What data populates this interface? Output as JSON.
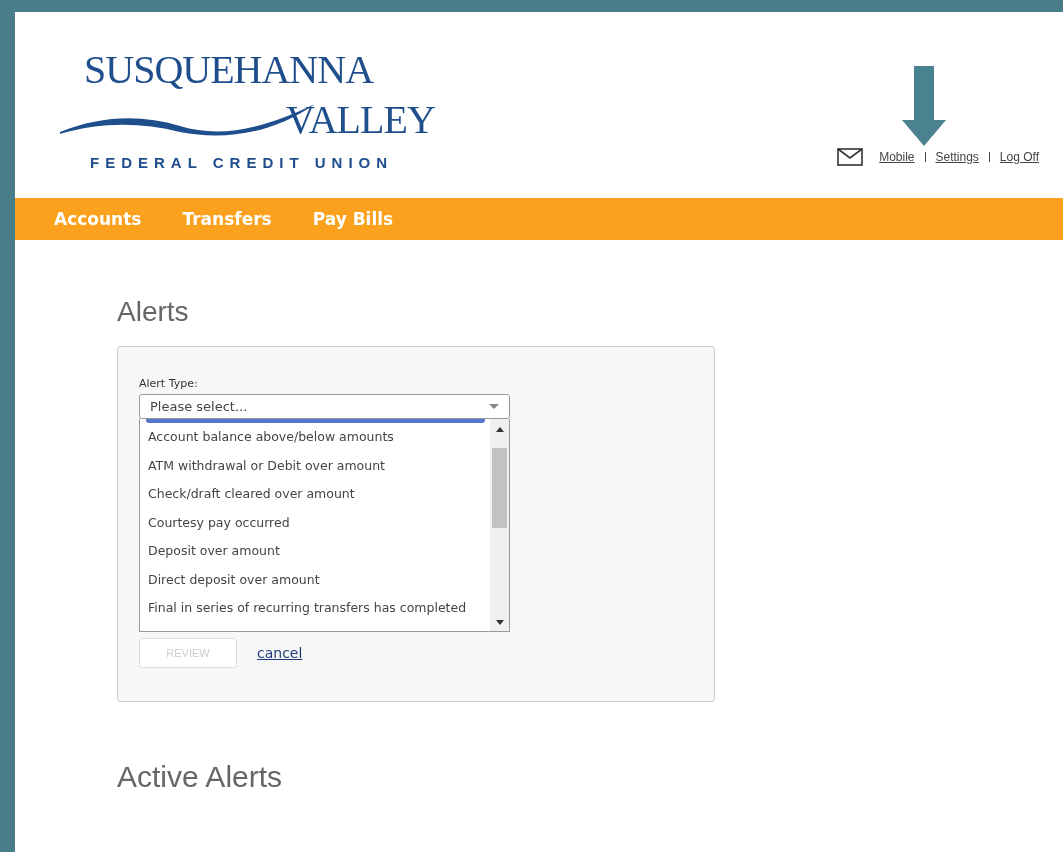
{
  "logo": {
    "line_1": "SUSQUEHANNA",
    "line_2": "VALLEY",
    "line_3": "FEDERAL CREDIT UNION"
  },
  "header_links": [
    {
      "label": "Mobile"
    },
    {
      "label": "Settings"
    },
    {
      "label": "Log Off"
    }
  ],
  "nav": [
    {
      "label": "Accounts"
    },
    {
      "label": "Transfers"
    },
    {
      "label": "Pay Bills"
    }
  ],
  "page_title": "Alerts",
  "form": {
    "label": "Alert Type:",
    "select": {
      "placeholder": "Please select...",
      "expanded": true
    },
    "options": [
      "Account balance above/below amounts",
      "ATM withdrawal or Debit over amount",
      "Check/draft cleared over amount",
      "Courtesy pay occurred",
      "Deposit over amount",
      "Direct deposit over amount",
      "Final in series of recurring transfers has completed"
    ],
    "review_button": {
      "label": "REVIEW",
      "disabled": true
    },
    "cancel_link": "cancel"
  },
  "section_title": "Active Alerts"
}
